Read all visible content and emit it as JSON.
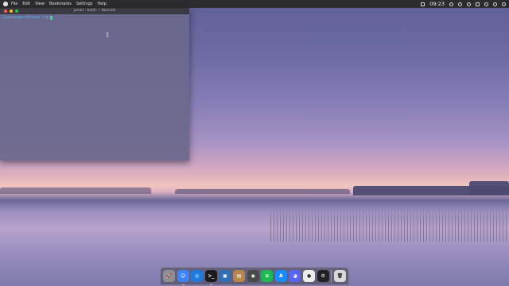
{
  "menubar": {
    "items": [
      "File",
      "Edit",
      "View",
      "Bookmarks",
      "Settings",
      "Help"
    ],
    "clock": "09:23",
    "tray_icons": [
      "screenshot-icon",
      "clock-icon",
      "info-icon",
      "network-icon",
      "window-icon",
      "volume-icon",
      "bell-icon",
      "search-icon"
    ]
  },
  "konsole": {
    "title": "junior : bash — Konsole",
    "prompt": "[junior@archlinux ~]$",
    "text_cursor": "I"
  },
  "dock": {
    "items": [
      {
        "name": "launchpad-icon",
        "color": "#8e8e93",
        "glyph": "🚀",
        "running": false
      },
      {
        "name": "finder-icon",
        "color": "#3b83f6",
        "glyph": "☺",
        "running": true
      },
      {
        "name": "safari-icon",
        "color": "#1e7be0",
        "glyph": "◎",
        "running": false
      },
      {
        "name": "terminal-icon",
        "color": "#1c1c1e",
        "glyph": ">_",
        "running": true
      },
      {
        "name": "preview-icon",
        "color": "#2f6fb5",
        "glyph": "▣",
        "running": false
      },
      {
        "name": "notes-icon",
        "color": "#b7864a",
        "glyph": "▤",
        "running": false
      },
      {
        "name": "screen-recorder-icon",
        "color": "#4a4a4a",
        "glyph": "◉",
        "running": false
      },
      {
        "name": "spotify-icon",
        "color": "#1db954",
        "glyph": "≋",
        "running": false
      },
      {
        "name": "app-store-icon",
        "color": "#1a8cff",
        "glyph": "A",
        "running": false
      },
      {
        "name": "discord-icon",
        "color": "#5865f2",
        "glyph": "◕",
        "running": false
      },
      {
        "name": "obs-icon",
        "color": "#ececec",
        "glyph": "●",
        "running": false
      },
      {
        "name": "steam-icon",
        "color": "#222222",
        "glyph": "⚙",
        "running": false
      },
      {
        "name": "trash-icon",
        "color": "#d9d9d9",
        "glyph": "🗑",
        "running": false
      }
    ]
  }
}
